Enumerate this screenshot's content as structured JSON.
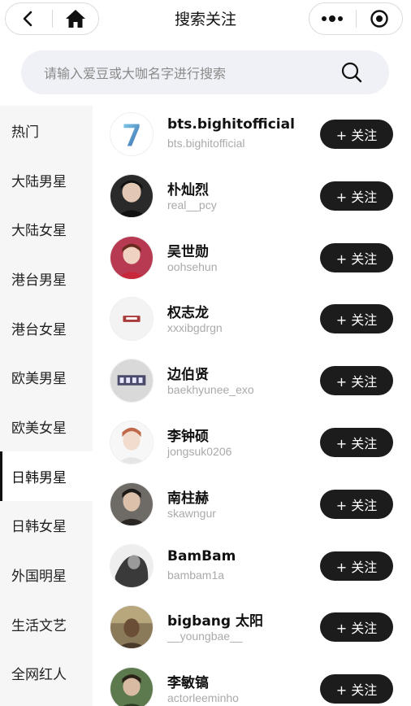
{
  "header": {
    "title": "搜索关注"
  },
  "search": {
    "placeholder": "请输入爱豆或大咖名字进行搜索"
  },
  "sidebar": {
    "items": [
      {
        "label": "热门"
      },
      {
        "label": "大陆男星"
      },
      {
        "label": "大陆女星"
      },
      {
        "label": "港台男星"
      },
      {
        "label": "港台女星"
      },
      {
        "label": "欧美男星"
      },
      {
        "label": "欧美女星"
      },
      {
        "label": "日韩男星"
      },
      {
        "label": "日韩女星"
      },
      {
        "label": "外国明星"
      },
      {
        "label": "生活文艺"
      },
      {
        "label": "全网红人"
      }
    ],
    "active_index": 7
  },
  "list": {
    "follow_label": "+ 关注",
    "items": [
      {
        "name": "bts.bighitofficial",
        "handle": "bts.bighitofficial",
        "avatar": "logo-7"
      },
      {
        "name": "朴灿烈",
        "handle": "real__pcy",
        "avatar": "photo"
      },
      {
        "name": "吴世勋",
        "handle": "oohsehun",
        "avatar": "photo"
      },
      {
        "name": "权志龙",
        "handle": "xxxibgdrgn",
        "avatar": "photo"
      },
      {
        "name": "边伯贤",
        "handle": "baekhyunee_exo",
        "avatar": "photo"
      },
      {
        "name": "李钟硕",
        "handle": "jongsuk0206",
        "avatar": "photo"
      },
      {
        "name": "南柱赫",
        "handle": "skawngur",
        "avatar": "photo"
      },
      {
        "name": "BamBam",
        "handle": "bambam1a",
        "avatar": "photo"
      },
      {
        "name": "bigbang 太阳",
        "handle": "__youngbae__",
        "avatar": "photo"
      },
      {
        "name": "李敏镐",
        "handle": "actorleeminho",
        "avatar": "photo"
      }
    ]
  },
  "colors": {
    "button_bg": "#1c1c1c",
    "sidebar_bg": "#f6f6f6",
    "search_bg": "#f0f1f6"
  }
}
